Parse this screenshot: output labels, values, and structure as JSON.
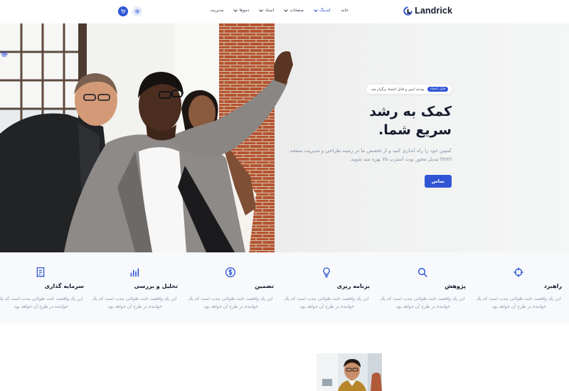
{
  "brand": {
    "name": "Landrick",
    "accent": "#2f55d4"
  },
  "nav": {
    "items": [
      {
        "label": "خانه",
        "has_dropdown": false,
        "active": false
      },
      {
        "label": "لندینگ",
        "has_dropdown": true,
        "active": true
      },
      {
        "label": "صفحات",
        "has_dropdown": true,
        "active": false
      },
      {
        "label": "اسناد",
        "has_dropdown": true,
        "active": false
      },
      {
        "label": "دموها",
        "has_dropdown": true,
        "active": false
      },
      {
        "label": "مدیریت",
        "has_dropdown": false,
        "active": false
      }
    ],
    "cart_icon": "cart-icon",
    "settings_icon": "gear-icon"
  },
  "hero": {
    "pill_badge": "قابل اعتماد",
    "pill_text": "بودجه ایمن و قابل اعتماد برگزار شد",
    "title_line1": "کمک به رشد",
    "title_line2": "سریع شما.",
    "description": "کمپین خود را راه اندازی کنید و از تخصص ما در زمینه طراحی و مدیریت صفحه html تبدیل محور بوت استرپ ۷۵ بهره مند شوید.",
    "cta_label": "تماس"
  },
  "features": [
    {
      "icon": "crosshair-icon",
      "title": "راهبرد",
      "desc": "این یک واقعیت ثابت طولانی مدت است که یک خواننده در طرح آن خواهد بود."
    },
    {
      "icon": "search-icon",
      "title": "پژوهش",
      "desc": "این یک واقعیت ثابت طولانی مدت است که یک خواننده در طرح آن خواهد بود."
    },
    {
      "icon": "lightbulb-icon",
      "title": "برنامه ریزی",
      "desc": "این یک واقعیت ثابت طولانی مدت است که یک خواننده در طرح آن خواهد بود."
    },
    {
      "icon": "dollar-icon",
      "title": "تضمین",
      "desc": "این یک واقعیت ثابت طولانی مدت است که یک خواننده در طرح آن خواهد بود."
    },
    {
      "icon": "bar-chart-icon",
      "title": "تحلیل و بررسی",
      "desc": "این یک واقعیت ثابت طولانی مدت است که یک خواننده در طرح آن خواهد بود."
    },
    {
      "icon": "receipt-icon",
      "title": "سرمایه گذاری",
      "desc": "این یک واقعیت ثابت طولانی مدت است که یک خواننده در طرح آن خواهد بود."
    }
  ]
}
